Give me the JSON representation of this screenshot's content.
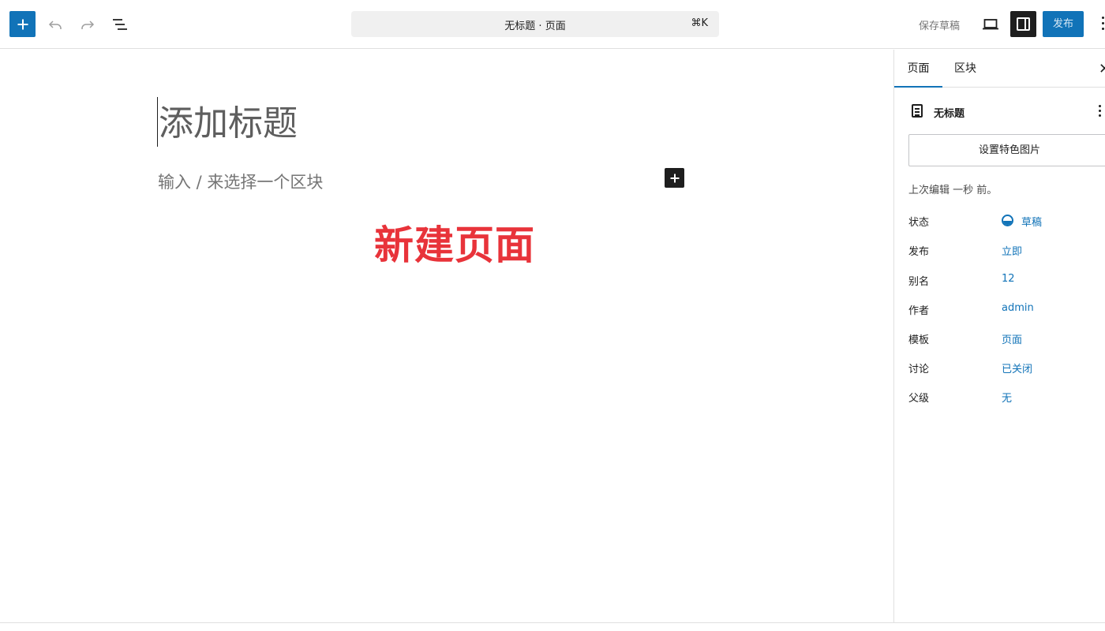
{
  "toolbar": {
    "add_icon": "plus-icon",
    "undo_icon": "undo-icon",
    "redo_icon": "redo-icon",
    "list_view_icon": "list-view-icon",
    "command_title": "无标题 · 页面",
    "command_shortcut": "⌘K",
    "save_draft_label": "保存草稿",
    "preview_icon": "desktop-icon",
    "settings_icon": "sidebar-icon",
    "publish_label": "发布",
    "more_icon": "kebab-icon",
    "accent": "#1173b8"
  },
  "editor": {
    "title_placeholder": "添加标题",
    "block_placeholder": "输入 / 来选择一个区块",
    "inserter_icon": "plus-icon",
    "annotation": "新建页面",
    "annotation_color": "#e8333a"
  },
  "sidebar": {
    "tabs": [
      {
        "label": "页面",
        "active": true
      },
      {
        "label": "区块",
        "active": false
      }
    ],
    "close_icon": "close-icon",
    "doc_icon": "page-icon",
    "doc_title": "无标题",
    "featured_image_label": "设置特色图片",
    "last_edited": "上次编辑 一秒 前。",
    "meta": [
      {
        "key": "状态",
        "value": "草稿"
      },
      {
        "key": "发布",
        "value": "立即"
      },
      {
        "key": "别名",
        "value": "12"
      },
      {
        "key": "作者",
        "value": "admin"
      },
      {
        "key": "模板",
        "value": "页面"
      },
      {
        "key": "讨论",
        "value": "已关闭"
      },
      {
        "key": "父级",
        "value": "无"
      }
    ]
  }
}
